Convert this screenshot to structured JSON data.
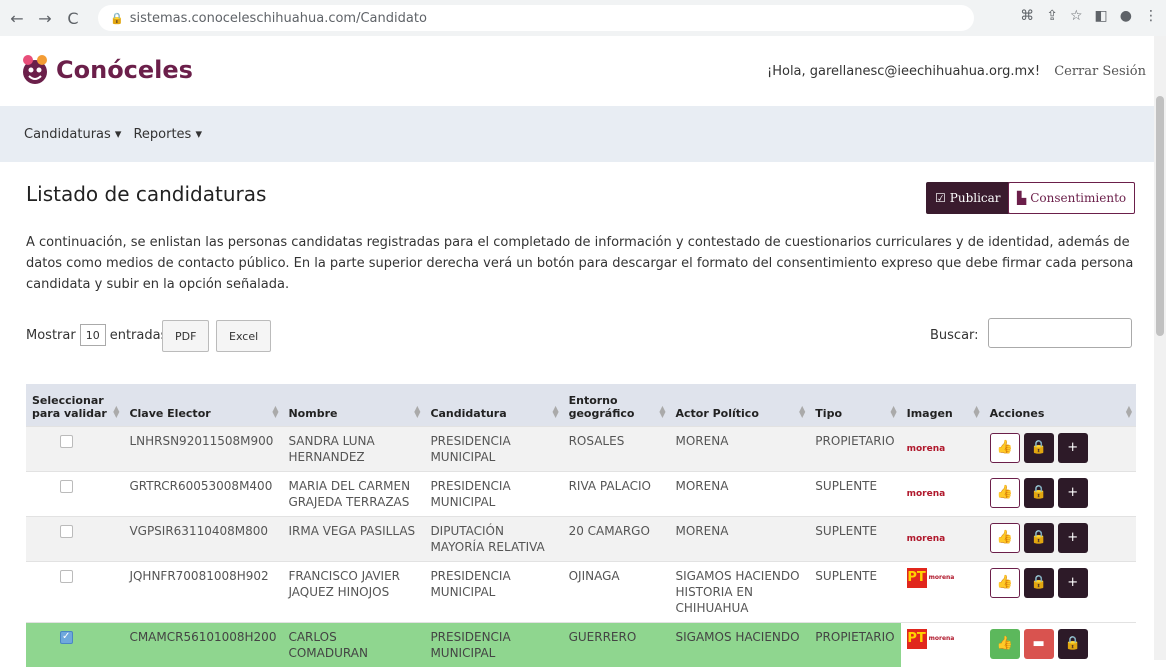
{
  "browser": {
    "url": "sistemas.conoceleschihuahua.com/Candidato"
  },
  "header": {
    "brand": "Conóceles",
    "greeting": "¡Hola, garellanesc@ieechihuahua.org.mx!",
    "logout": "Cerrar Sesión"
  },
  "menu": {
    "items": [
      {
        "label": "Candidaturas ▾"
      },
      {
        "label": "Reportes ▾"
      }
    ]
  },
  "page": {
    "title": "Listado de candidaturas",
    "publish_label": "Publicar",
    "consent_label": "Consentimiento",
    "intro": "A continuación, se enlistan las personas candidatas registradas para el completado de información y contestado de cuestionarios curriculares y de identidad, además de datos como medios de contacto público. En la parte superior derecha verá un botón para descargar el formato del consentimiento expreso que debe firmar cada persona candidata y subir en la opción señalada."
  },
  "controls": {
    "show_label": "Mostrar",
    "page_size": "10",
    "entries_label": "entradas",
    "pdf_label": "PDF",
    "excel_label": "Excel",
    "search_label": "Buscar:"
  },
  "table": {
    "headers": {
      "select_line1": "Seleccionar",
      "select_line2": "para validar",
      "clave": "Clave Elector",
      "nombre": "Nombre",
      "candidatura": "Candidatura",
      "entorno_line1": "Entorno",
      "entorno_line2": "geográfico",
      "actor": "Actor Político",
      "tipo": "Tipo",
      "imagen": "Imagen",
      "acciones": "Acciones"
    },
    "rows": [
      {
        "checked": false,
        "clave": "LNHRSN92011508M900",
        "nombre": "SANDRA LUNA HERNANDEZ",
        "candidatura": "PRESIDENCIA MUNICIPAL",
        "entorno": "ROSALES",
        "actor": "MORENA",
        "tipo": "PROPIETARIO",
        "party_text": "morena"
      },
      {
        "checked": false,
        "clave": "GRTRCR60053008M400",
        "nombre": "MARIA DEL CARMEN GRAJEDA TERRAZAS",
        "candidatura": "PRESIDENCIA MUNICIPAL",
        "entorno": "RIVA PALACIO",
        "actor": "MORENA",
        "tipo": "SUPLENTE",
        "party_text": "morena"
      },
      {
        "checked": false,
        "clave": "VGPSIR63110408M800",
        "nombre": "IRMA VEGA PASILLAS",
        "candidatura": "DIPUTACIÓN MAYORÍA RELATIVA",
        "entorno": "20 CAMARGO",
        "actor": "MORENA",
        "tipo": "SUPLENTE",
        "party_text": "morena"
      },
      {
        "checked": false,
        "clave": "JQHNFR70081008H902",
        "nombre": "FRANCISCO JAVIER JAQUEZ HINOJOS",
        "candidatura": "PRESIDENCIA MUNICIPAL",
        "entorno": "OJINAGA",
        "actor": "SIGAMOS HACIENDO HISTORIA EN CHIHUAHUA",
        "tipo": "SUPLENTE",
        "party_text": "morena",
        "coalition_text": "PT"
      },
      {
        "checked": true,
        "clave": "CMAMCR56101008H200",
        "nombre": "CARLOS COMADURAN",
        "candidatura": "PRESIDENCIA MUNICIPAL",
        "entorno": "GUERRERO",
        "actor": "SIGAMOS HACIENDO",
        "tipo": "PROPIETARIO",
        "party_text": "morena",
        "coalition_text": "PT"
      }
    ]
  },
  "colors": {
    "brand": "#6b1f4a",
    "header_bg": "#dfe3ec",
    "selected_row": "#8fd68f"
  }
}
